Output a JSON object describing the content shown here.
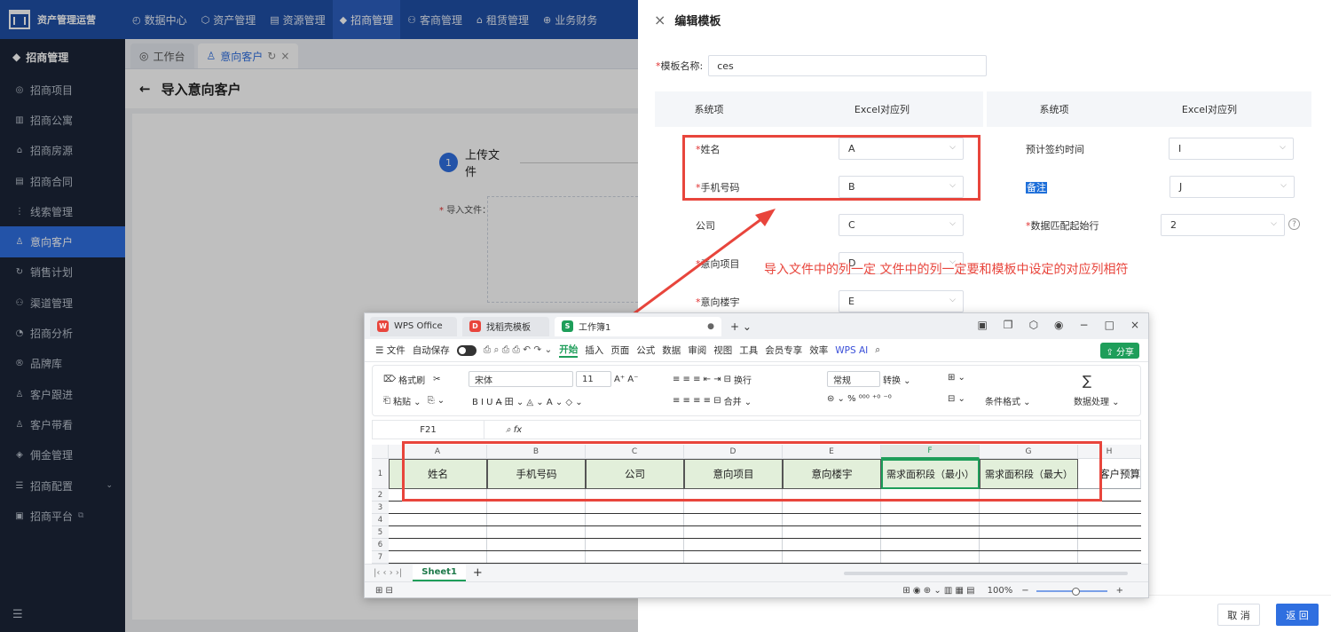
{
  "app": {
    "logo_text": "资产管理运营"
  },
  "top_nav": [
    {
      "icon": "◴",
      "label": "数据中心"
    },
    {
      "icon": "⬡",
      "label": "资产管理"
    },
    {
      "icon": "▤",
      "label": "资源管理"
    },
    {
      "icon": "◆",
      "label": "招商管理"
    },
    {
      "icon": "⚇",
      "label": "客商管理"
    },
    {
      "icon": "⌂",
      "label": "租赁管理"
    },
    {
      "icon": "⊕",
      "label": "业务财务"
    }
  ],
  "sidebar": {
    "header": "招商管理",
    "items": [
      {
        "icon": "◎",
        "label": "招商项目"
      },
      {
        "icon": "▥",
        "label": "招商公寓"
      },
      {
        "icon": "⌂",
        "label": "招商房源"
      },
      {
        "icon": "▤",
        "label": "招商合同"
      },
      {
        "icon": "⋮",
        "label": "线索管理"
      },
      {
        "icon": "♙",
        "label": "意向客户"
      },
      {
        "icon": "↻",
        "label": "销售计划"
      },
      {
        "icon": "⚇",
        "label": "渠道管理"
      },
      {
        "icon": "◔",
        "label": "招商分析"
      },
      {
        "icon": "®",
        "label": "品牌库"
      },
      {
        "icon": "♙",
        "label": "客户跟进"
      },
      {
        "icon": "♙",
        "label": "客户带看"
      },
      {
        "icon": "◈",
        "label": "佣金管理"
      },
      {
        "icon": "☰",
        "label": "招商配置",
        "caret": "⌄"
      },
      {
        "icon": "▣",
        "label": "招商平台",
        "suffix": "⧉"
      }
    ],
    "bottom_icon": "☰"
  },
  "tabs": [
    {
      "icon": "◎",
      "label": "工作台"
    },
    {
      "icon": "♙",
      "label": "意向客户",
      "refresh": "↻",
      "close": "×"
    }
  ],
  "page": {
    "back_icon": "←",
    "title": "导入意向客户",
    "step_number": "1",
    "step_label": "上传文件",
    "import_label": "导入文件：",
    "req_mark": "*"
  },
  "drawer": {
    "close_icon": "×",
    "title": "编辑模板",
    "name_label": "模板名称:",
    "name_value": "ces",
    "headers": [
      "系统项",
      "Excel对应列",
      "系统项",
      "Excel对应列"
    ],
    "left_rows": [
      {
        "label": "姓名",
        "required": true,
        "value": "A"
      },
      {
        "label": "手机号码",
        "required": true,
        "value": "B"
      },
      {
        "label": "公司",
        "required": false,
        "value": "C"
      },
      {
        "label": "意向项目",
        "required": true,
        "value": "D"
      },
      {
        "label": "意向楼宇",
        "required": true,
        "value": "E"
      }
    ],
    "right_rows": [
      {
        "label": "预计签约时间",
        "required": false,
        "value": "I"
      },
      {
        "label": "备注",
        "required": false,
        "value": "J",
        "highlighted": true
      },
      {
        "label": "数据匹配起始行",
        "required": true,
        "value": "2"
      }
    ],
    "help_icon": "?",
    "chevron": "⌵",
    "annotation": "导入文件中的列一定 文件中的列一定要和模板中设定的对应列相符",
    "cancel": "取 消",
    "back": "返 回"
  },
  "wps": {
    "tabs": [
      {
        "badge": "W",
        "label": "WPS Office"
      },
      {
        "badge": "D",
        "label": "找稻壳模板"
      },
      {
        "badge": "S",
        "label": "工作簿1",
        "dot": "●"
      }
    ],
    "new_tab": "+ ⌄",
    "window_controls": [
      "▣",
      "❐",
      "⬡",
      "◉",
      "−",
      "□",
      "×"
    ],
    "menu": {
      "file": "☰ 文件",
      "autosave": "自动保存",
      "tools": "⎙ ⌕ ⎙ ⎙ ↶ ↷ ⌄",
      "items": [
        "开始",
        "插入",
        "页面",
        "公式",
        "数据",
        "审阅",
        "视图",
        "工具",
        "会员专享",
        "效率"
      ],
      "ai": "WPS AI",
      "search": "⌕",
      "share": "⇪ 分享"
    },
    "ribbon": {
      "format_painter": "格式刷",
      "cut": "✂",
      "paste": "粘贴 ⌄",
      "copy": "⎘ ⌄",
      "font": "宋体",
      "size": "11",
      "font_tools": "A⁺ A⁻",
      "style_tools": "B  I  U  A̶  田 ⌄  ◬ ⌄  A ⌄  ◇ ⌄",
      "align_top": "≡  ≡  ≡  ⇤  ⇥",
      "wrap": "换行",
      "align_bottom": "≡  ≡  ≡  ≡  ⊟",
      "merge": "合并 ⌄",
      "number_format": "常规",
      "convert": "转换 ⌄",
      "number_tools": "⊜ ⌄  %  ⁰⁰⁰  ⁺⁰  ⁻⁰",
      "rows_cols": "⊞ ⌄",
      "cond_format": "条件格式 ⌄",
      "cells": "⊟ ⌄",
      "data_proc": "数据处理 ⌄",
      "sum": "∑"
    },
    "cell_ref": "F21",
    "fx": "⌕  fx",
    "columns": [
      "A",
      "B",
      "C",
      "D",
      "E",
      "F",
      "G",
      "H"
    ],
    "header_row": [
      "姓名",
      "手机号码",
      "公司",
      "意向项目",
      "意向楼宇",
      "需求面积段（最小）",
      "需求面积段（最大）",
      "客户预算"
    ],
    "row_numbers": [
      "1",
      "2",
      "3",
      "4",
      "5",
      "6",
      "7"
    ],
    "sheet_nav": "|‹  ‹  ›  ›|",
    "sheet_name": "Sheet1",
    "add_sheet": "+",
    "status_left": "⊞  ⊟",
    "status_tools": "⊞   ◉   ⊕ ⌄   ▥   ▦   ▤",
    "zoom": "100%",
    "zoom_minus": "−",
    "zoom_plus": "+"
  }
}
